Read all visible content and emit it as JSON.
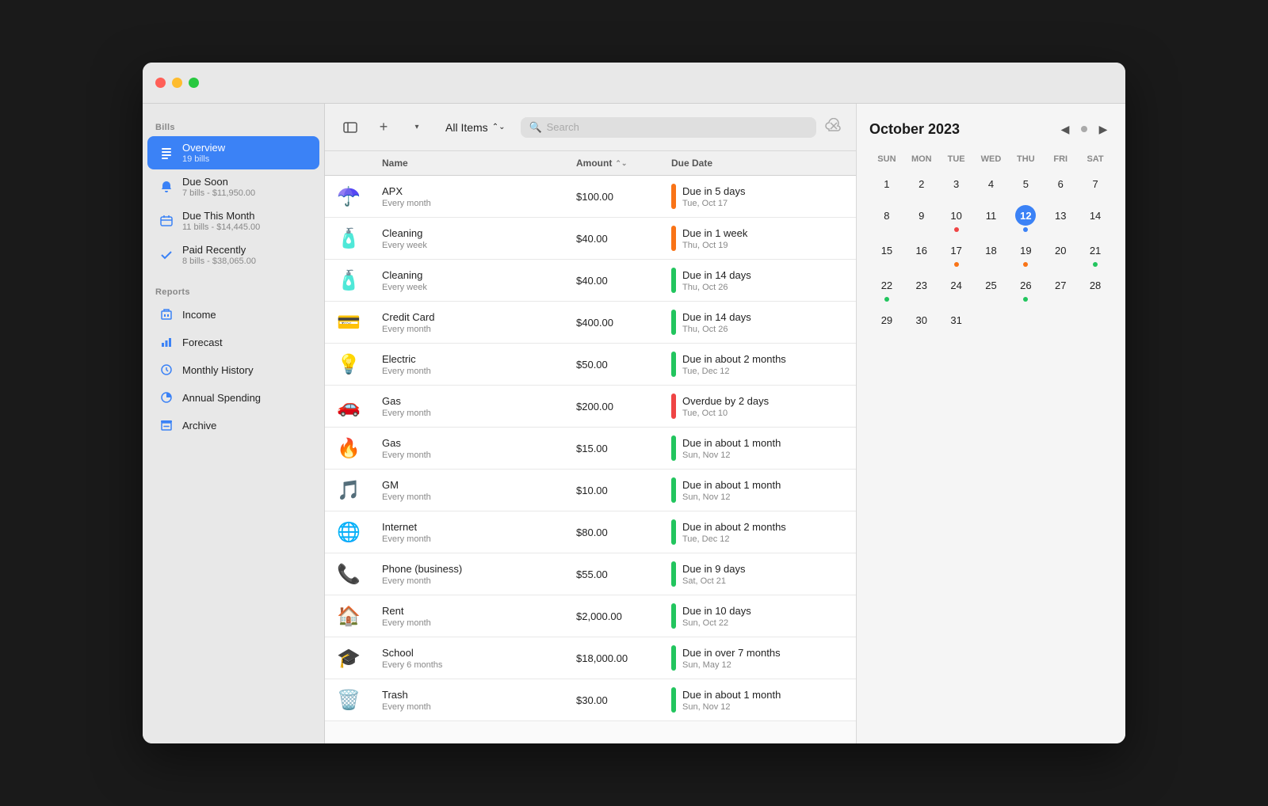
{
  "window": {
    "title": "Bills"
  },
  "sidebar": {
    "bills_label": "Bills",
    "reports_label": "Reports",
    "items": [
      {
        "id": "overview",
        "label": "Overview",
        "sub": "19 bills",
        "icon": "list",
        "active": true
      },
      {
        "id": "due-soon",
        "label": "Due Soon",
        "sub": "7 bills - $11,950.00",
        "icon": "bell",
        "active": false
      },
      {
        "id": "due-this-month",
        "label": "Due This Month",
        "sub": "11 bills - $14,445.00",
        "icon": "calendar",
        "active": false
      },
      {
        "id": "paid-recently",
        "label": "Paid Recently",
        "sub": "8 bills - $38,065.00",
        "icon": "check",
        "active": false
      }
    ],
    "report_items": [
      {
        "id": "income",
        "label": "Income",
        "icon": "building"
      },
      {
        "id": "forecast",
        "label": "Forecast",
        "icon": "chart"
      },
      {
        "id": "monthly-history",
        "label": "Monthly History",
        "icon": "clock"
      },
      {
        "id": "annual-spending",
        "label": "Annual Spending",
        "icon": "pie"
      },
      {
        "id": "archive",
        "label": "Archive",
        "icon": "archive"
      }
    ]
  },
  "toolbar": {
    "all_items_label": "All Items",
    "search_placeholder": "Search"
  },
  "table": {
    "headers": [
      "",
      "Name",
      "Amount",
      "Due Date"
    ],
    "rows": [
      {
        "icon": "☂️",
        "name": "APX",
        "frequency": "Every month",
        "amount": "$100.00",
        "due_label": "Due in 5 days",
        "due_date": "Tue, Oct 17",
        "indicator_color": "#f97316"
      },
      {
        "icon": "🧴",
        "name": "Cleaning",
        "frequency": "Every week",
        "amount": "$40.00",
        "due_label": "Due in 1 week",
        "due_date": "Thu, Oct 19",
        "indicator_color": "#f97316"
      },
      {
        "icon": "🧴",
        "name": "Cleaning",
        "frequency": "Every week",
        "amount": "$40.00",
        "due_label": "Due in 14 days",
        "due_date": "Thu, Oct 26",
        "indicator_color": "#22c55e"
      },
      {
        "icon": "💳",
        "name": "Credit Card",
        "frequency": "Every month",
        "amount": "$400.00",
        "due_label": "Due in 14 days",
        "due_date": "Thu, Oct 26",
        "indicator_color": "#22c55e"
      },
      {
        "icon": "💡",
        "name": "Electric",
        "frequency": "Every month",
        "amount": "$50.00",
        "due_label": "Due in about 2 months",
        "due_date": "Tue, Dec 12",
        "indicator_color": "#22c55e"
      },
      {
        "icon": "🚗",
        "name": "Gas",
        "frequency": "Every month",
        "amount": "$200.00",
        "due_label": "Overdue by 2 days",
        "due_date": "Tue, Oct 10",
        "indicator_color": "#ef4444"
      },
      {
        "icon": "🔥",
        "name": "Gas",
        "frequency": "Every month",
        "amount": "$15.00",
        "due_label": "Due in about 1 month",
        "due_date": "Sun, Nov 12",
        "indicator_color": "#22c55e"
      },
      {
        "icon": "🎵",
        "name": "GM",
        "frequency": "Every month",
        "amount": "$10.00",
        "due_label": "Due in about 1 month",
        "due_date": "Sun, Nov 12",
        "indicator_color": "#22c55e"
      },
      {
        "icon": "🌐",
        "name": "Internet",
        "frequency": "Every month",
        "amount": "$80.00",
        "due_label": "Due in about 2 months",
        "due_date": "Tue, Dec 12",
        "indicator_color": "#22c55e"
      },
      {
        "icon": "📞",
        "name": "Phone (business)",
        "frequency": "Every month",
        "amount": "$55.00",
        "due_label": "Due in 9 days",
        "due_date": "Sat, Oct 21",
        "indicator_color": "#22c55e"
      },
      {
        "icon": "🏠",
        "name": "Rent",
        "frequency": "Every month",
        "amount": "$2,000.00",
        "due_label": "Due in 10 days",
        "due_date": "Sun, Oct 22",
        "indicator_color": "#22c55e"
      },
      {
        "icon": "🎓",
        "name": "School",
        "frequency": "Every 6 months",
        "amount": "$18,000.00",
        "due_label": "Due in over 7 months",
        "due_date": "Sun, May 12",
        "indicator_color": "#22c55e"
      },
      {
        "icon": "🗑️",
        "name": "Trash",
        "frequency": "Every month",
        "amount": "$30.00",
        "due_label": "Due in about 1 month",
        "due_date": "Sun, Nov 12",
        "indicator_color": "#22c55e"
      }
    ]
  },
  "calendar": {
    "title": "October 2023",
    "day_labels": [
      "SUN",
      "MON",
      "TUE",
      "WED",
      "THU",
      "FRI",
      "SAT"
    ],
    "weeks": [
      [
        {
          "num": "",
          "today": false,
          "dots": []
        },
        {
          "num": "",
          "today": false,
          "dots": []
        },
        {
          "num": "",
          "today": false,
          "dots": []
        },
        {
          "num": "",
          "today": false,
          "dots": []
        },
        {
          "num": "",
          "today": false,
          "dots": []
        },
        {
          "num": "",
          "today": false,
          "dots": []
        },
        {
          "num": "7",
          "today": false,
          "dots": []
        }
      ],
      [
        {
          "num": "1",
          "today": false,
          "dots": []
        },
        {
          "num": "2",
          "today": false,
          "dots": []
        },
        {
          "num": "3",
          "today": false,
          "dots": []
        },
        {
          "num": "4",
          "today": false,
          "dots": []
        },
        {
          "num": "5",
          "today": false,
          "dots": []
        },
        {
          "num": "6",
          "today": false,
          "dots": []
        },
        {
          "num": "7",
          "today": false,
          "dots": []
        }
      ],
      [
        {
          "num": "8",
          "today": false,
          "dots": []
        },
        {
          "num": "9",
          "today": false,
          "dots": []
        },
        {
          "num": "10",
          "today": false,
          "dots": [
            "red"
          ]
        },
        {
          "num": "11",
          "today": false,
          "dots": []
        },
        {
          "num": "12",
          "today": true,
          "dots": [
            "blue"
          ]
        },
        {
          "num": "13",
          "today": false,
          "dots": []
        },
        {
          "num": "14",
          "today": false,
          "dots": []
        }
      ],
      [
        {
          "num": "15",
          "today": false,
          "dots": []
        },
        {
          "num": "16",
          "today": false,
          "dots": []
        },
        {
          "num": "17",
          "today": false,
          "dots": [
            "orange"
          ]
        },
        {
          "num": "18",
          "today": false,
          "dots": []
        },
        {
          "num": "19",
          "today": false,
          "dots": [
            "orange"
          ]
        },
        {
          "num": "20",
          "today": false,
          "dots": []
        },
        {
          "num": "21",
          "today": false,
          "dots": [
            "green"
          ]
        }
      ],
      [
        {
          "num": "22",
          "today": false,
          "dots": [
            "green"
          ]
        },
        {
          "num": "23",
          "today": false,
          "dots": []
        },
        {
          "num": "24",
          "today": false,
          "dots": []
        },
        {
          "num": "25",
          "today": false,
          "dots": []
        },
        {
          "num": "26",
          "today": false,
          "dots": [
            "green"
          ]
        },
        {
          "num": "27",
          "today": false,
          "dots": []
        },
        {
          "num": "28",
          "today": false,
          "dots": []
        }
      ],
      [
        {
          "num": "29",
          "today": false,
          "dots": []
        },
        {
          "num": "30",
          "today": false,
          "dots": []
        },
        {
          "num": "31",
          "today": false,
          "dots": []
        },
        {
          "num": "",
          "today": false,
          "dots": []
        },
        {
          "num": "",
          "today": false,
          "dots": []
        },
        {
          "num": "",
          "today": false,
          "dots": []
        },
        {
          "num": "",
          "today": false,
          "dots": []
        }
      ]
    ]
  }
}
